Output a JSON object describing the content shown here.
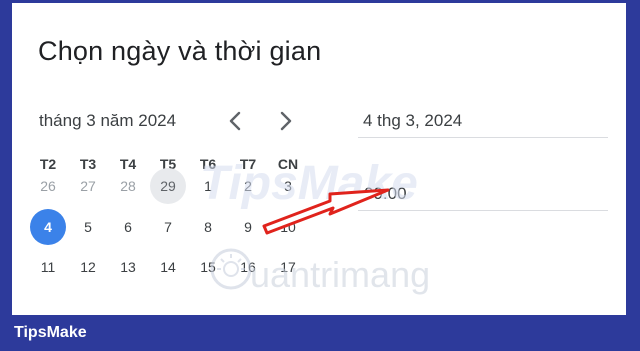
{
  "dialog": {
    "title": "Chọn ngày và thời gian"
  },
  "calendar": {
    "month_label": "tháng 3 năm 2024",
    "weekdays": [
      "T2",
      "T3",
      "T4",
      "T5",
      "T6",
      "T7",
      "CN"
    ],
    "weeks": [
      [
        "26",
        "27",
        "28",
        "29",
        "1",
        "2",
        "3"
      ],
      [
        "4",
        "5",
        "6",
        "7",
        "8",
        "9",
        "10"
      ],
      [
        "11",
        "12",
        "13",
        "14",
        "15",
        "16",
        "17"
      ]
    ],
    "selected_day": "4",
    "today_day": "29"
  },
  "date_field": {
    "value": "4 thg 3, 2024"
  },
  "time_field": {
    "value": "09:00"
  },
  "watermark": {
    "top_text": "TipsMake",
    "bottom_text": "uantrimang"
  },
  "footer": {
    "brand": "TipsMake"
  },
  "colors": {
    "frame": "#2d3a9b",
    "selected": "#3b82e9",
    "arrow": "#e0231c"
  },
  "icons": {
    "prev": "chevron-left-icon",
    "next": "chevron-right-icon"
  }
}
